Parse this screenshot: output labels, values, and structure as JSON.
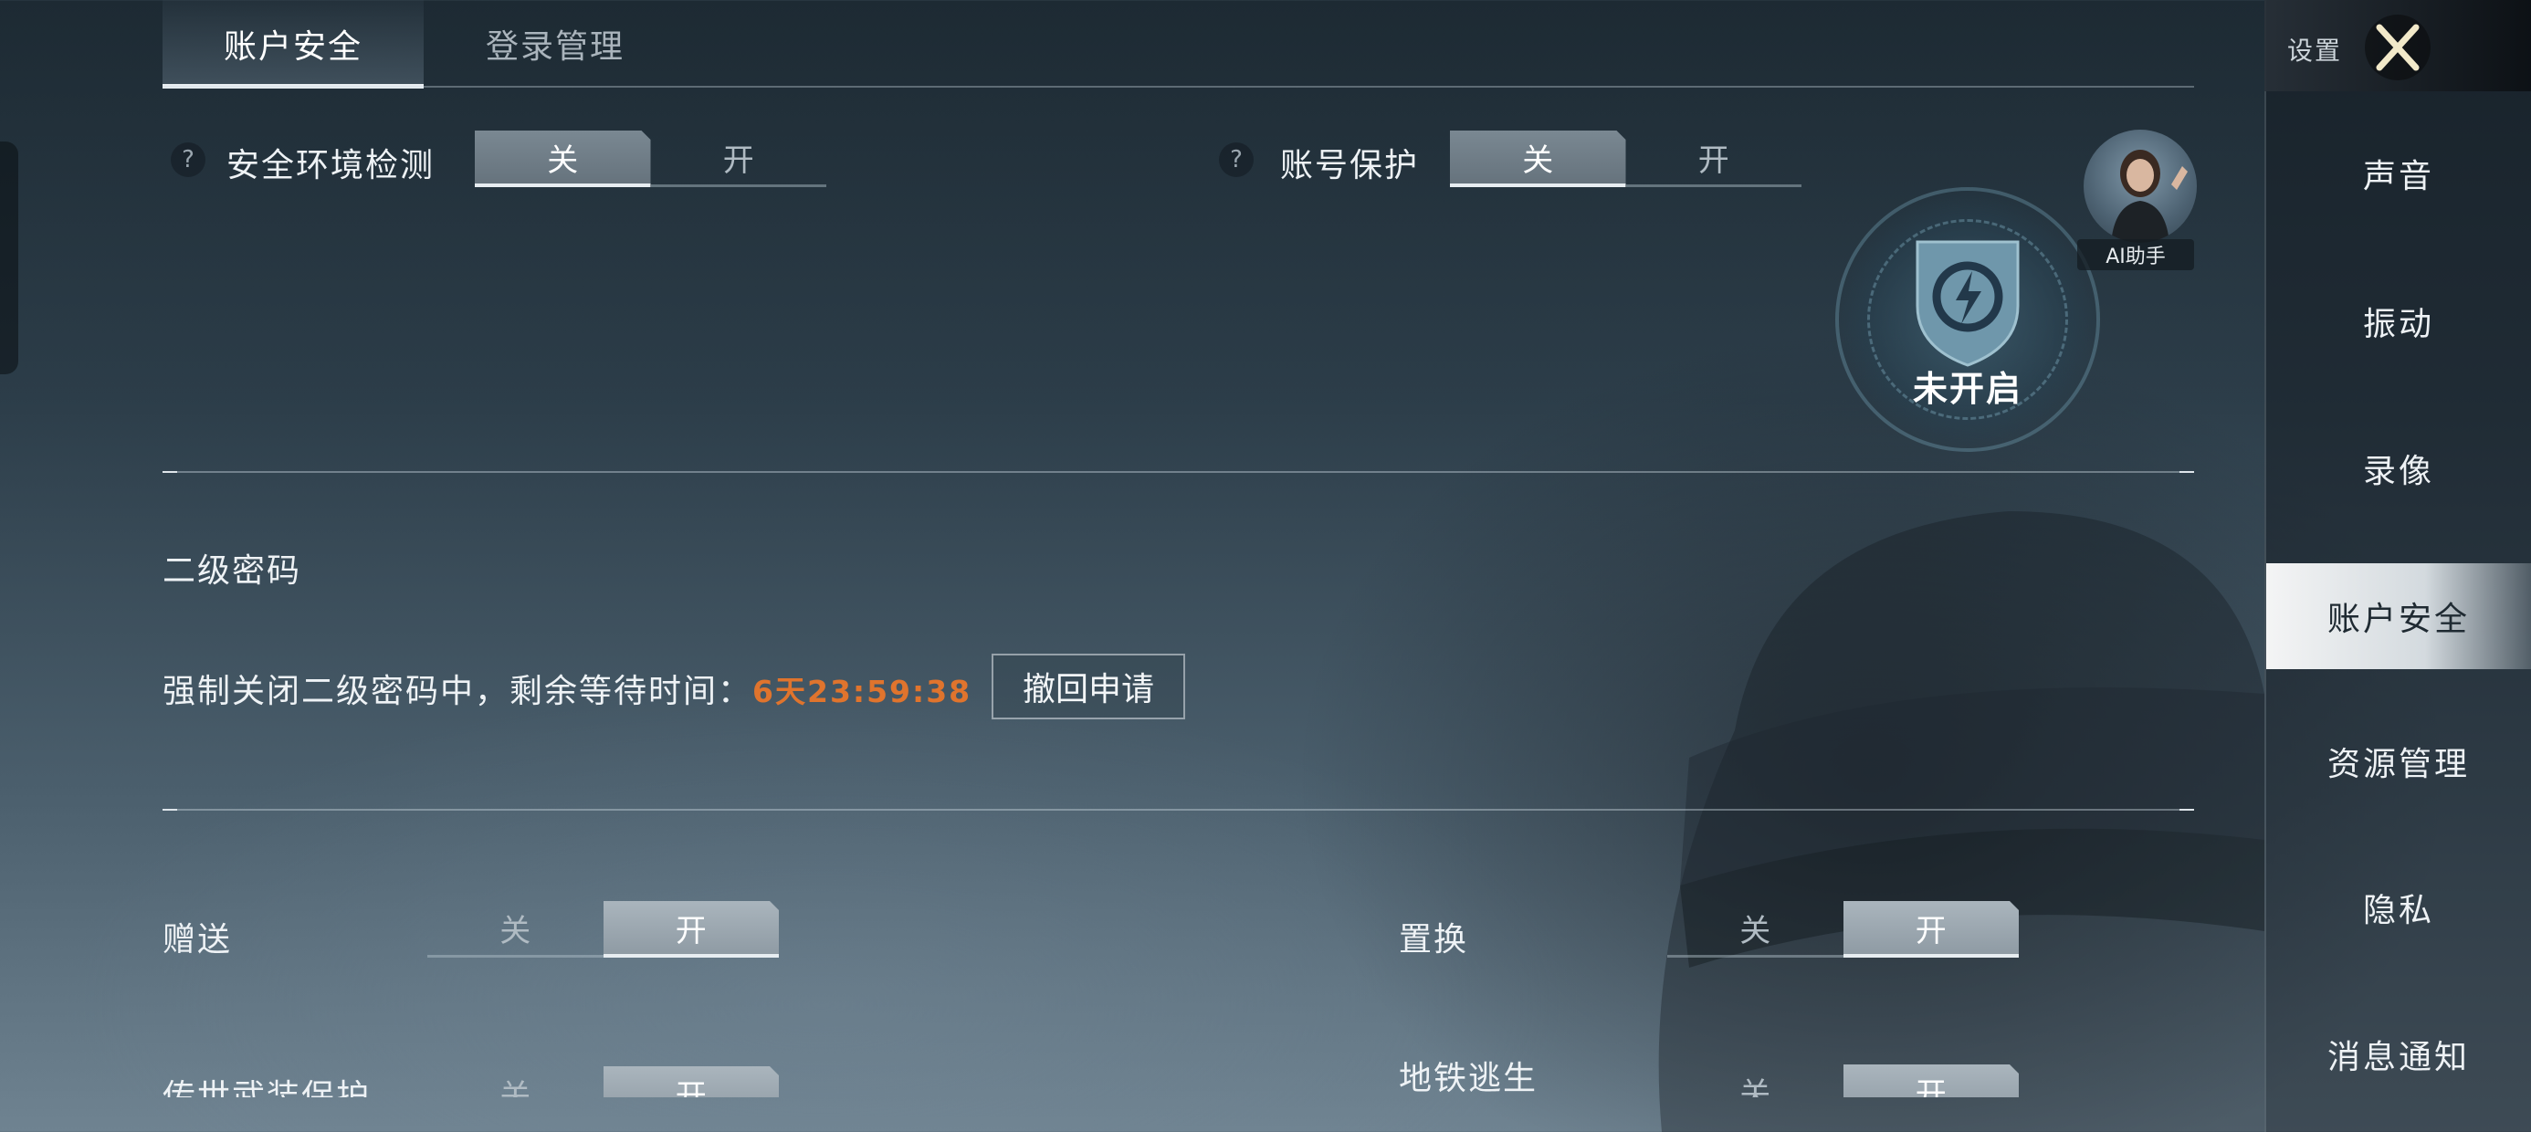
{
  "tabs": [
    {
      "label": "账户安全",
      "active": true
    },
    {
      "label": "登录管理",
      "active": false
    }
  ],
  "help_icon_glyph": "?",
  "security_env": {
    "label": "安全环境检测",
    "off": "关",
    "on": "开",
    "selected": "关"
  },
  "account_protect": {
    "label": "账号保护",
    "off": "关",
    "on": "开",
    "selected": "关"
  },
  "shield": {
    "status": "未开启",
    "icon": "shield-lightning-icon"
  },
  "ai_assistant": {
    "label": "AI助手"
  },
  "second_password": {
    "title": "二级密码",
    "message": "强制关闭二级密码中，剩余等待时间：",
    "countdown": "6天23:59:38",
    "revoke_button": "撤回申请"
  },
  "toggles": [
    {
      "label": "赠送",
      "off": "关",
      "on": "开",
      "selected": "开"
    },
    {
      "label": "置换",
      "off": "关",
      "on": "开",
      "selected": "开"
    },
    {
      "label": "传世武装保护",
      "off": "关",
      "on": "开",
      "selected": "开"
    },
    {
      "label": "地铁逃生",
      "off": "关",
      "on": "开",
      "selected": "开"
    }
  ],
  "sidebar": {
    "title": "设置",
    "items": [
      {
        "label": "声音"
      },
      {
        "label": "振动"
      },
      {
        "label": "录像"
      },
      {
        "label": "账户安全",
        "active": true
      },
      {
        "label": "资源管理"
      },
      {
        "label": "隐私"
      },
      {
        "label": "消息通知"
      }
    ]
  },
  "colors": {
    "countdown": "#e0742d",
    "active_sidebar": "#ffffff",
    "shield": "#5f8aa0"
  }
}
